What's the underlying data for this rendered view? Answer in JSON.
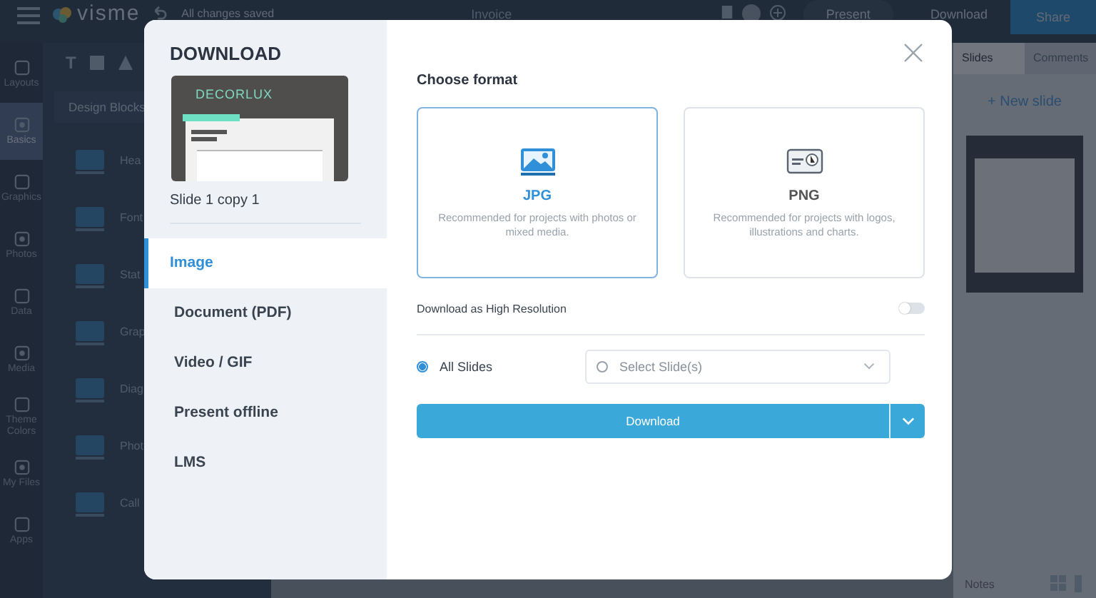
{
  "app": {
    "logo": "visme",
    "save_status": "All changes saved",
    "document_title": "Invoice",
    "top_actions": [
      {
        "label": "Present",
        "kind": "ghost"
      },
      {
        "label": "Download",
        "kind": "text"
      },
      {
        "label": "Share",
        "kind": "primary"
      }
    ],
    "left_nav": [
      {
        "label": "Layouts",
        "selected": false
      },
      {
        "label": "Basics",
        "selected": true
      },
      {
        "label": "Graphics",
        "selected": false
      },
      {
        "label": "Photos",
        "selected": false
      },
      {
        "label": "Data",
        "selected": false
      },
      {
        "label": "Media",
        "selected": false
      },
      {
        "label": "Theme Colors",
        "selected": false
      },
      {
        "label": "My Files",
        "selected": false
      },
      {
        "label": "Apps",
        "selected": false
      }
    ],
    "panel": {
      "text_tool": "T",
      "tab": "Design Blocks",
      "blocks": [
        "Hea",
        "Font",
        "Stat",
        "Grap",
        "Diag",
        "Phot",
        "Call"
      ]
    },
    "right_panel": {
      "tabs": [
        {
          "label": "Slides",
          "selected": true
        },
        {
          "label": "Comments",
          "selected": false
        }
      ],
      "new_slide": "+ New slide",
      "notes": "Notes"
    }
  },
  "dialog": {
    "title": "DOWNLOAD",
    "preview": {
      "brand": "DECORLUX"
    },
    "slide_name": "Slide 1 copy 1",
    "menu": [
      {
        "label": "Image",
        "selected": true
      },
      {
        "label": "Document (PDF)",
        "selected": false
      },
      {
        "label": "Video / GIF",
        "selected": false
      },
      {
        "label": "Present offline",
        "selected": false
      },
      {
        "label": "LMS",
        "selected": false
      }
    ],
    "section_title": "Choose format",
    "formats": [
      {
        "name": "JPG",
        "description": "Recommended for projects with photos or mixed media.",
        "selected": true
      },
      {
        "name": "PNG",
        "description": "Recommended for projects with logos, illustrations and charts.",
        "selected": false
      }
    ],
    "high_res": {
      "label": "Download as High Resolution",
      "on": false
    },
    "scope": [
      {
        "kind": "radio",
        "label": "All Slides",
        "selected": true
      },
      {
        "kind": "dropdown",
        "placeholder": "Select Slide(s)",
        "selected": false
      }
    ],
    "download_button": "Download"
  }
}
